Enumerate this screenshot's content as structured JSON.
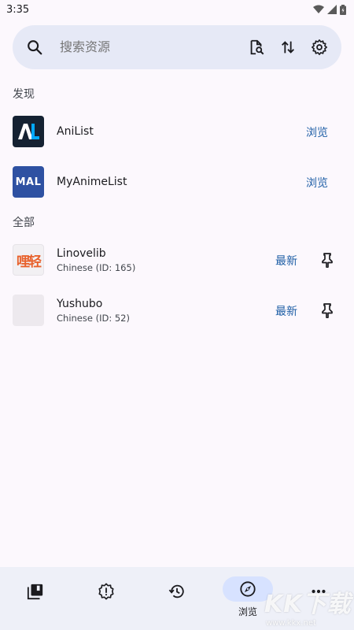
{
  "status_bar": {
    "time": "3:35",
    "icons": [
      "wifi-icon",
      "signal-icon",
      "battery-icon"
    ]
  },
  "search": {
    "placeholder": "搜索资源",
    "icons": [
      "search-icon",
      "global-search-icon",
      "migrate-icon",
      "settings-icon"
    ]
  },
  "sections": {
    "discover": "发现",
    "all": "全部"
  },
  "discover_items": [
    {
      "name": "AniList",
      "action": "浏览",
      "logo_text": "AL",
      "logo_bg": "#152232"
    },
    {
      "name": "MyAnimeList",
      "action": "浏览",
      "logo_text": "MAL",
      "logo_bg": "#2e51a2"
    }
  ],
  "sources": [
    {
      "name": "Linovelib",
      "sub": "Chinese (ID: 165)",
      "action": "最新",
      "logo_text": "哩轻"
    },
    {
      "name": "Yushubo",
      "sub": "Chinese (ID: 52)",
      "action": "最新",
      "logo_text": ""
    }
  ],
  "bottom_nav": {
    "items": [
      {
        "icon": "library-icon"
      },
      {
        "icon": "updates-icon"
      },
      {
        "icon": "history-icon"
      },
      {
        "icon": "browse-compass-icon",
        "label": "浏览",
        "active": true
      },
      {
        "icon": "more-icon"
      }
    ]
  },
  "watermark": {
    "main": "KK下载",
    "url": "www.kkx.net"
  },
  "colors": {
    "accent": "#1f5fa6",
    "search_bg": "#e6e9f6",
    "nav_bg": "#eef0f8",
    "nav_pill": "#d7e2ff"
  }
}
